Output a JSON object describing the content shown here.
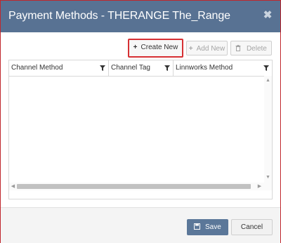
{
  "dialog": {
    "title": "Payment Methods - THERANGE The_Range",
    "close_glyph": "✖"
  },
  "toolbar": {
    "create_new_label": "Create New",
    "create_new_glyph": "+",
    "add_new_label": "Add New",
    "add_new_glyph": "+",
    "delete_label": "Delete",
    "delete_glyph": "🗑"
  },
  "grid": {
    "columns": [
      {
        "label": "Channel Method"
      },
      {
        "label": "Channel Tag"
      },
      {
        "label": "Linnworks Method"
      }
    ],
    "rows": []
  },
  "footer": {
    "save_label": "Save",
    "save_glyph": "💾",
    "cancel_label": "Cancel"
  },
  "colors": {
    "titlebar": "#587293",
    "highlight_border": "#d63033",
    "save_button": "#5b7799"
  }
}
